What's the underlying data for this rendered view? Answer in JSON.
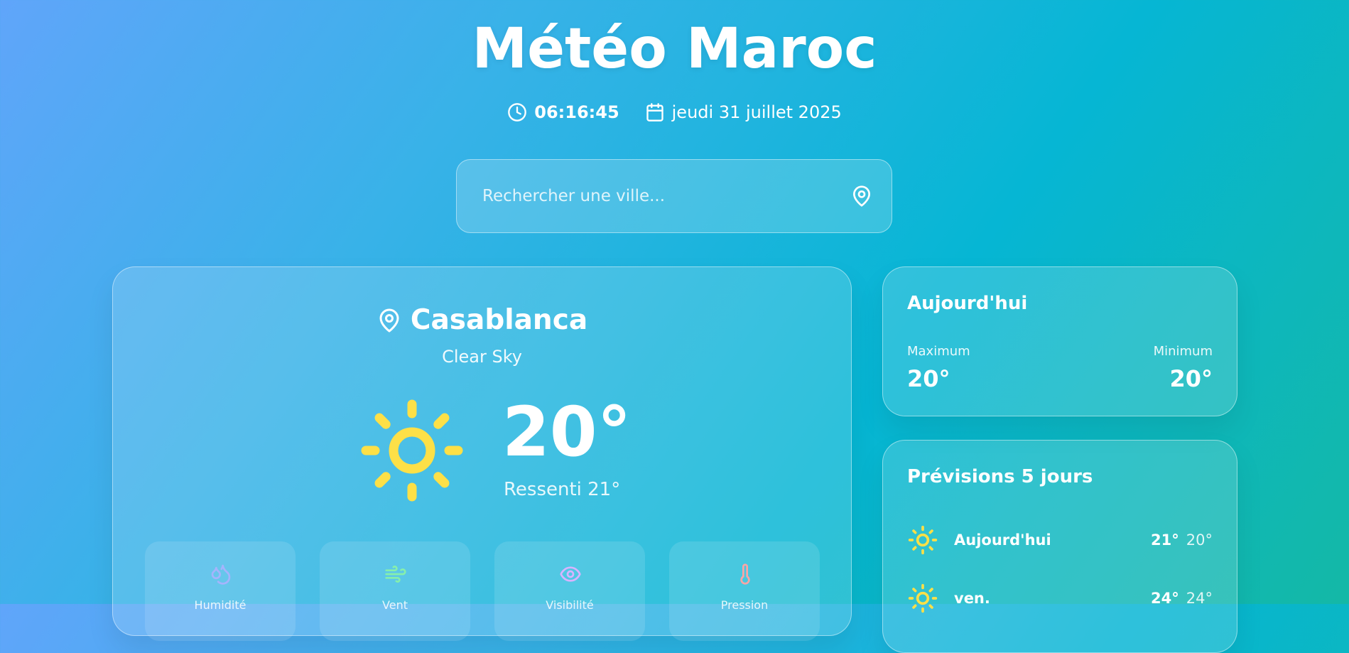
{
  "header": {
    "title": "Météo Maroc",
    "time": "06:16:45",
    "date": "jeudi 31 juillet 2025"
  },
  "search": {
    "placeholder": "Rechercher une ville..."
  },
  "current": {
    "city": "Casablanca",
    "condition": "Clear Sky",
    "temperature": "20°",
    "feels_like": "Ressenti 21°",
    "weather_icon": "sun-icon",
    "stats": [
      {
        "label": "Humidité",
        "icon": "droplets-icon",
        "color": "#a5b4fc"
      },
      {
        "label": "Vent",
        "icon": "wind-icon",
        "color": "#86efac"
      },
      {
        "label": "Visibilité",
        "icon": "eye-icon",
        "color": "#d8b4fe"
      },
      {
        "label": "Pression",
        "icon": "thermometer-icon",
        "color": "#fca5a5"
      }
    ]
  },
  "today": {
    "title": "Aujourd'hui",
    "max_label": "Maximum",
    "max_value": "20°",
    "min_label": "Minimum",
    "min_value": "20°"
  },
  "forecast": {
    "title": "Prévisions 5 jours",
    "days": [
      {
        "day": "Aujourd'hui",
        "high": "21°",
        "low": "20°",
        "icon": "sun-icon"
      },
      {
        "day": "ven.",
        "high": "24°",
        "low": "24°",
        "icon": "sun-icon"
      }
    ]
  },
  "colors": {
    "sun": "#fde047",
    "background_start": "#60a5fa",
    "background_end": "#06b6d4"
  }
}
